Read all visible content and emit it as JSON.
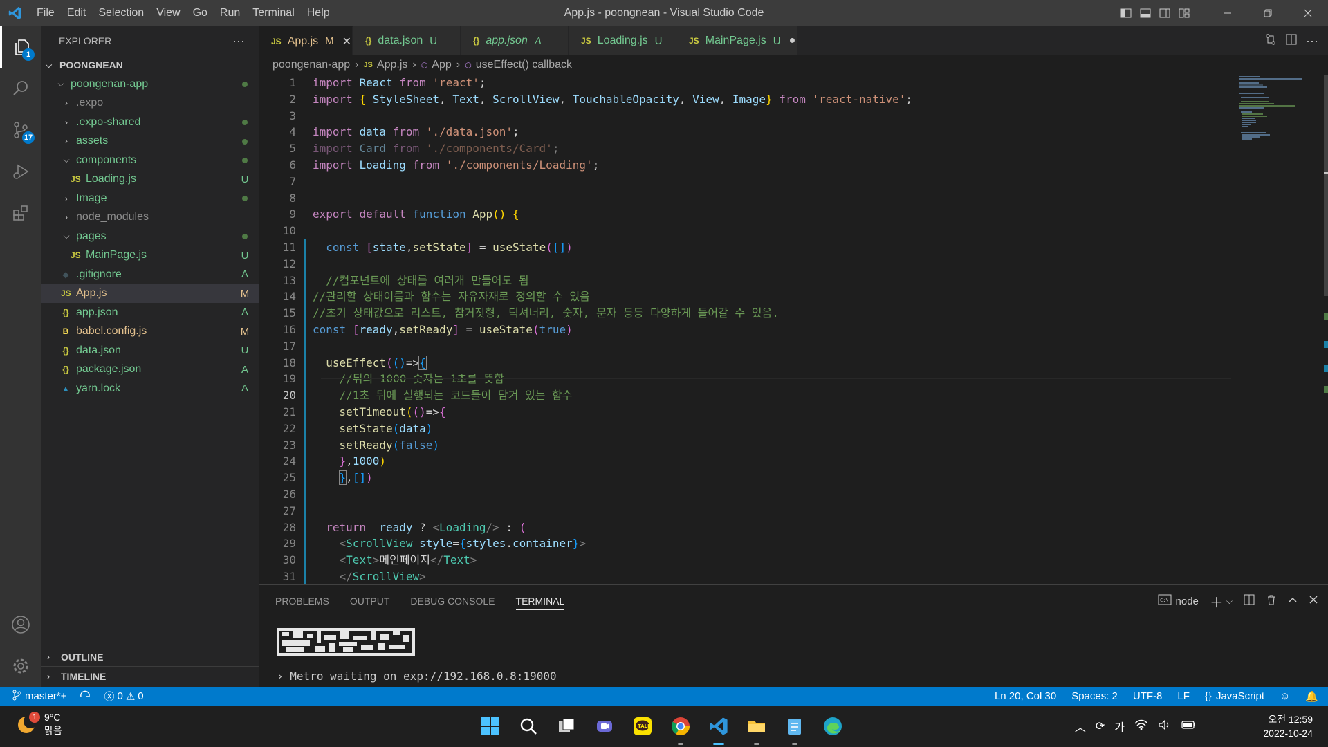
{
  "window": {
    "title": "App.js - poongnean - Visual Studio Code",
    "menus": [
      "File",
      "Edit",
      "Selection",
      "View",
      "Go",
      "Run",
      "Terminal",
      "Help"
    ]
  },
  "activity_bar": {
    "explorer_badge": "1",
    "source_control_badge": "17"
  },
  "sidebar": {
    "title": "EXPLORER",
    "more_label": "···",
    "root": "POONGNEAN",
    "tree": [
      {
        "name": "poongenan-app",
        "type": "folder-open",
        "indent": 1,
        "status": "dot"
      },
      {
        "name": ".expo",
        "type": "folder",
        "indent": 2,
        "status": "",
        "dim": true
      },
      {
        "name": ".expo-shared",
        "type": "folder",
        "indent": 2,
        "status": "dot"
      },
      {
        "name": "assets",
        "type": "folder",
        "indent": 2,
        "status": "dot"
      },
      {
        "name": "components",
        "type": "folder-open",
        "indent": 2,
        "status": "dot"
      },
      {
        "name": "Loading.js",
        "type": "js",
        "indent": 3,
        "status": "U"
      },
      {
        "name": "Image",
        "type": "folder",
        "indent": 2,
        "status": "dot"
      },
      {
        "name": "node_modules",
        "type": "folder",
        "indent": 2,
        "status": "",
        "dim": true
      },
      {
        "name": "pages",
        "type": "folder-open",
        "indent": 2,
        "status": "dot"
      },
      {
        "name": "MainPage.js",
        "type": "js",
        "indent": 3,
        "status": "U"
      },
      {
        "name": ".gitignore",
        "type": "git",
        "indent": 2,
        "status": "A"
      },
      {
        "name": "App.js",
        "type": "js",
        "indent": 2,
        "status": "M",
        "selected": true
      },
      {
        "name": "app.json",
        "type": "json",
        "indent": 2,
        "status": "A"
      },
      {
        "name": "babel.config.js",
        "type": "babel",
        "indent": 2,
        "status": "M"
      },
      {
        "name": "data.json",
        "type": "json",
        "indent": 2,
        "status": "U"
      },
      {
        "name": "package.json",
        "type": "json",
        "indent": 2,
        "status": "A"
      },
      {
        "name": "yarn.lock",
        "type": "yarn",
        "indent": 2,
        "status": "A"
      }
    ],
    "outline_label": "OUTLINE",
    "timeline_label": "TIMELINE"
  },
  "tabs": [
    {
      "label": "App.js",
      "icon": "JS",
      "status": "M",
      "active": true,
      "italic": false,
      "close": "✕"
    },
    {
      "label": "data.json",
      "icon": "{}",
      "status": "U",
      "active": false,
      "italic": false,
      "close": ""
    },
    {
      "label": "app.json",
      "icon": "{}",
      "status": "A",
      "active": false,
      "italic": true,
      "close": ""
    },
    {
      "label": "Loading.js",
      "icon": "JS",
      "status": "U",
      "active": false,
      "italic": false,
      "close": ""
    },
    {
      "label": "MainPage.js",
      "icon": "JS",
      "status": "U",
      "active": false,
      "italic": false,
      "close": "●"
    }
  ],
  "breadcrumb": {
    "folder": "poongenan-app",
    "file": "App.js",
    "symbol": "App",
    "callback": "useEffect() callback"
  },
  "editor": {
    "current_line": 20
  },
  "panel": {
    "tabs": [
      "PROBLEMS",
      "OUTPUT",
      "DEBUG CONSOLE",
      "TERMINAL"
    ],
    "active_tab": "TERMINAL",
    "terminal_name": "node",
    "prompt": "›",
    "metro_text": "Metro waiting on ",
    "metro_url": "exp://192.168.0.8:19000"
  },
  "statusbar": {
    "branch": "master*+",
    "errors": "0",
    "warnings": "0",
    "position": "Ln 20, Col 30",
    "spaces": "Spaces: 2",
    "encoding": "UTF-8",
    "eol": "LF",
    "language": "JavaScript"
  },
  "taskbar": {
    "weather_temp": "9°C",
    "weather_desc": "맑음",
    "weather_badge": "1",
    "ime": "가",
    "time": "오전 12:59",
    "date": "2022-10-24"
  },
  "colors": {
    "accent": "#007acc",
    "modified": "#e2c08d",
    "untracked": "#73c991"
  }
}
